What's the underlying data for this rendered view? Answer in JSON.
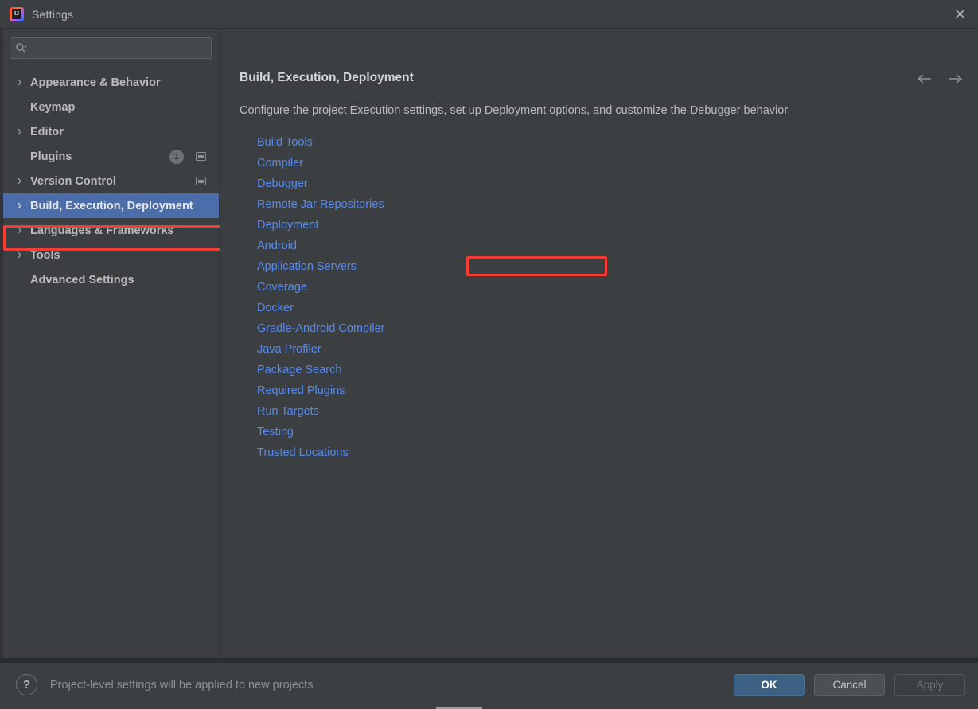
{
  "window": {
    "title": "Settings",
    "app_icon": "intellij-idea-logo",
    "close_icon": "close-icon"
  },
  "search": {
    "value": "",
    "placeholder": "",
    "icon": "search-icon"
  },
  "sidebar": {
    "items": [
      {
        "label": "Appearance & Behavior",
        "expandable": true,
        "selected": false,
        "badge": null,
        "project_icon": false
      },
      {
        "label": "Keymap",
        "expandable": false,
        "selected": false,
        "badge": null,
        "project_icon": false
      },
      {
        "label": "Editor",
        "expandable": true,
        "selected": false,
        "badge": null,
        "project_icon": false
      },
      {
        "label": "Plugins",
        "expandable": false,
        "selected": false,
        "badge": "1",
        "project_icon": true
      },
      {
        "label": "Version Control",
        "expandable": true,
        "selected": false,
        "badge": null,
        "project_icon": true
      },
      {
        "label": "Build, Execution, Deployment",
        "expandable": true,
        "selected": true,
        "badge": null,
        "project_icon": false
      },
      {
        "label": "Languages & Frameworks",
        "expandable": true,
        "selected": false,
        "badge": null,
        "project_icon": false
      },
      {
        "label": "Tools",
        "expandable": true,
        "selected": false,
        "badge": null,
        "project_icon": false
      },
      {
        "label": "Advanced Settings",
        "expandable": false,
        "selected": false,
        "badge": null,
        "project_icon": false
      }
    ]
  },
  "main": {
    "title": "Build, Execution, Deployment",
    "description": "Configure the project Execution settings, set up Deployment options, and customize the Debugger behavior",
    "back_icon": "arrow-left-icon",
    "forward_icon": "arrow-right-icon",
    "links": [
      "Build Tools",
      "Compiler",
      "Debugger",
      "Remote Jar Repositories",
      "Deployment",
      "Android",
      "Application Servers",
      "Coverage",
      "Docker",
      "Gradle-Android Compiler",
      "Java Profiler",
      "Package Search",
      "Required Plugins",
      "Run Targets",
      "Testing",
      "Trusted Locations"
    ]
  },
  "footer": {
    "help_label": "?",
    "note": "Project-level settings will be applied to new projects",
    "ok_label": "OK",
    "cancel_label": "Cancel",
    "apply_label": "Apply"
  },
  "colors": {
    "background": "#3c3f41",
    "selection_blue": "#4b6eab",
    "link_blue": "#568af2",
    "annotation_red": "#f93b33",
    "primary_button": "#3d6185"
  }
}
